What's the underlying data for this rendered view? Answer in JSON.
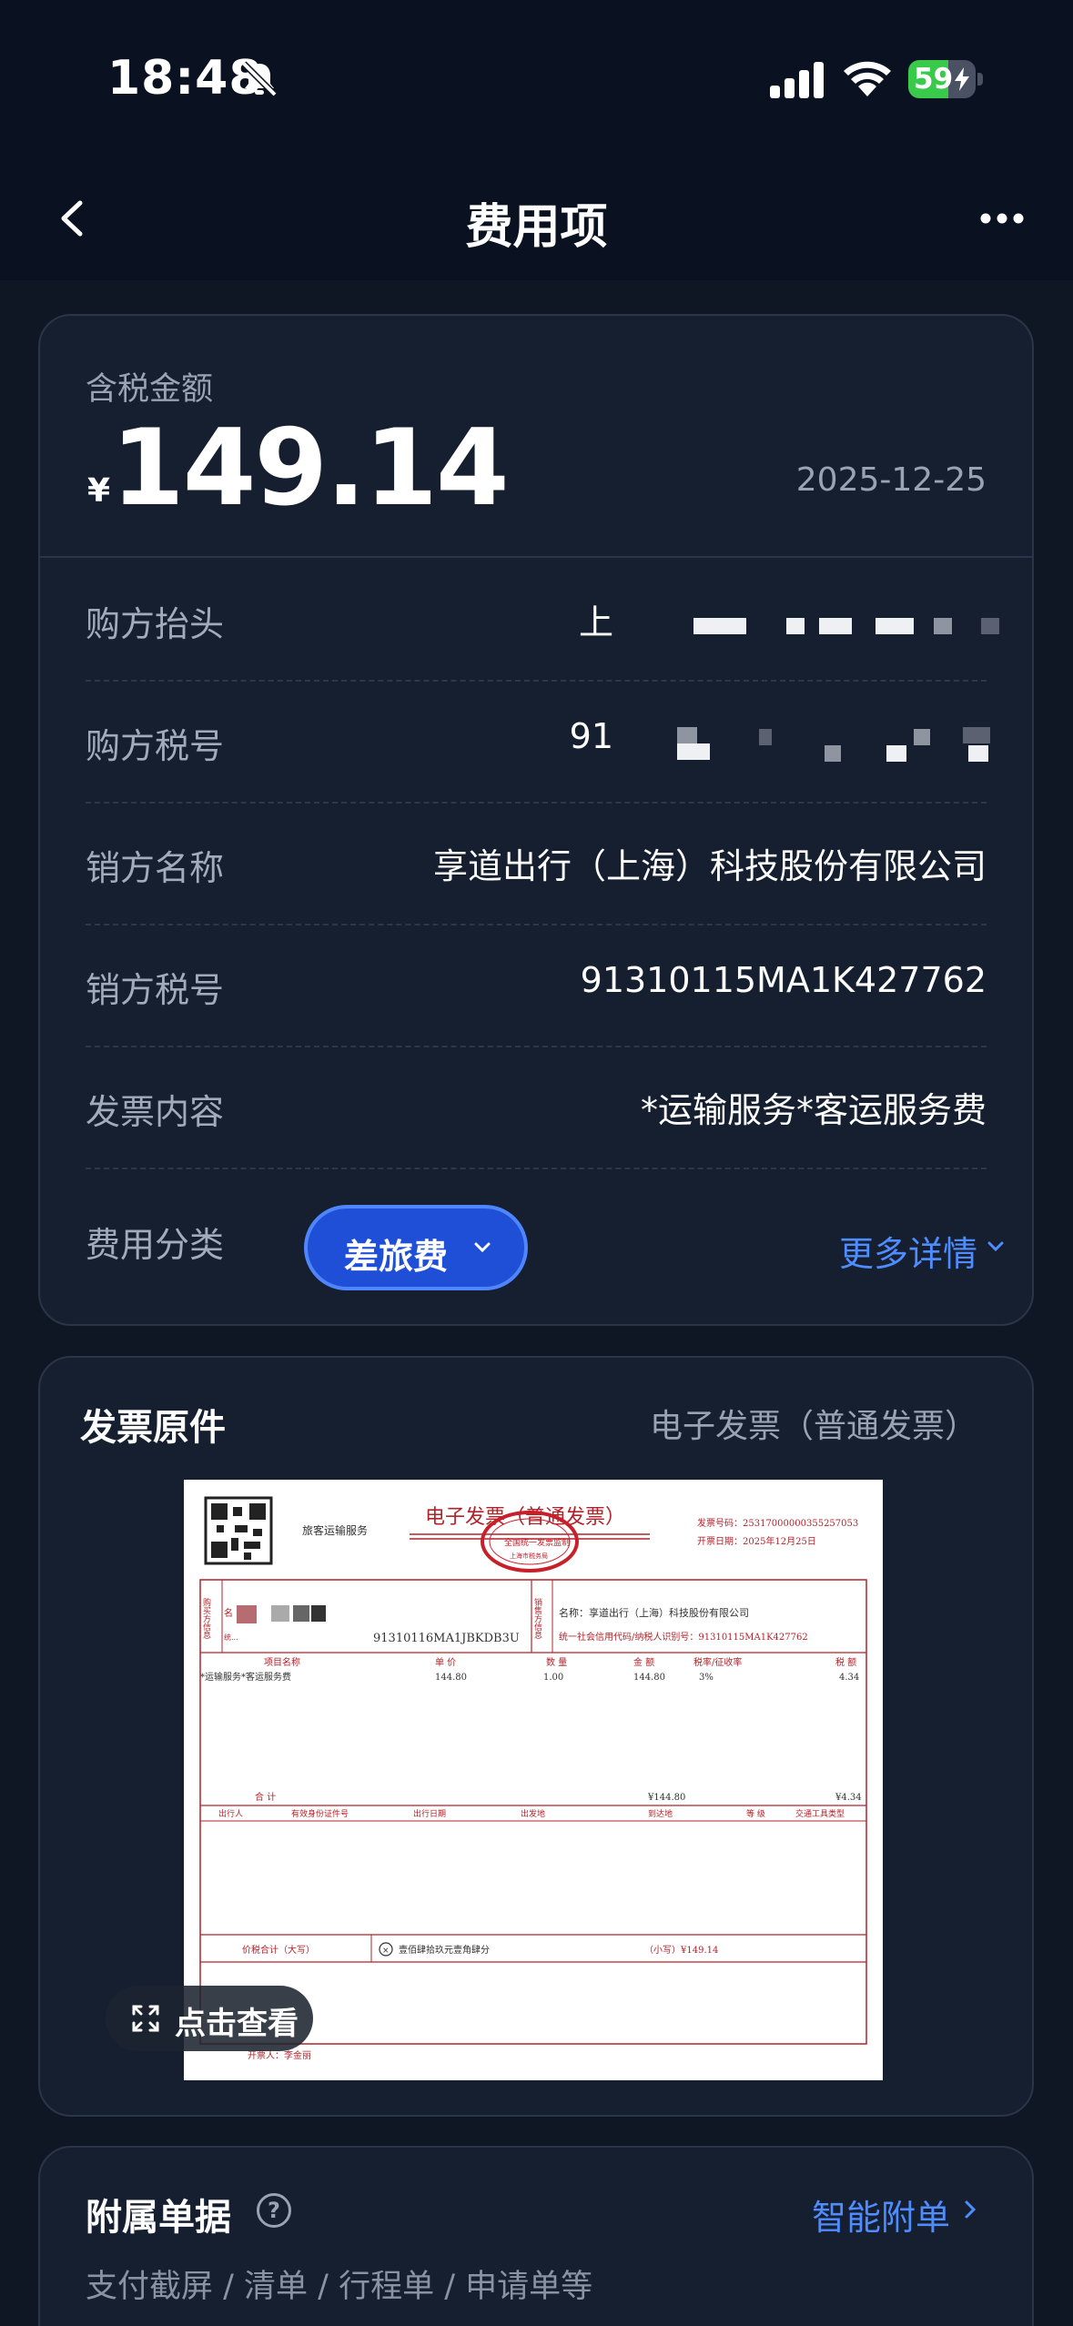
{
  "status_bar": {
    "time": "18:48",
    "battery": "59",
    "battery_level": 0.59
  },
  "nav": {
    "title": "费用项"
  },
  "amount_card": {
    "tax_label": "含税金额",
    "currency": "¥",
    "amount": "149.14",
    "date": "2025-12-25",
    "rows": [
      {
        "label": "购方抬头",
        "value": "上"
      },
      {
        "label": "购方税号",
        "value": "91"
      },
      {
        "label": "销方名称",
        "value": "享道出行（上海）科技股份有限公司"
      },
      {
        "label": "销方税号",
        "value": "91310115MA1K427762"
      },
      {
        "label": "发票内容",
        "value": "*运输服务*客运服务费"
      }
    ],
    "category_label": "费用分类",
    "category_value": "差旅费",
    "more_details": "更多详情"
  },
  "invoice_card": {
    "title": "发票原件",
    "type": "电子发票（普通发票）",
    "view_button": "点击查看",
    "image": {
      "service_tag": "旅客运输服务",
      "heading": "电子发票（普通发票）",
      "invoice_no": "发票号码：25317000000355257053",
      "invoice_date": "开票日期：2025年12月25日",
      "buyer_side": "购买方信息",
      "buyer_tax_id": "91310116MA1JBKDB3U",
      "seller_side": "销售方信息",
      "seller_name": "名称：享道出行（上海）科技股份有限公司",
      "seller_tax_id": "统一社会信用代码/纳税人识别号：91310115MA1K427762",
      "col_item": "项目名称",
      "col_price": "单 价",
      "col_qty": "数 量",
      "col_amount": "金 额",
      "col_rate": "税率/征收率",
      "col_tax": "税 额",
      "item_name": "*运输服务*客运服务费",
      "item_price": "144.80",
      "item_qty": "1.00",
      "item_amount": "144.80",
      "item_rate": "3%",
      "item_tax": "4.34",
      "total_label": "合 计",
      "total_amount": "¥144.80",
      "total_tax": "¥4.34",
      "trav_cols": [
        "出行人",
        "有效身份证件号",
        "出行日期",
        "出发地",
        "到达地",
        "等 级",
        "交通工具类型"
      ],
      "sum_label": "价税合计（大写）",
      "sum_words": "壹佰肆拾玖元壹角肆分",
      "sum_small": "（小写）¥149.14",
      "issuer": "开票人：李金丽"
    }
  },
  "attachments_card": {
    "title": "附属单据",
    "help": "?",
    "smart_attach": "智能附单",
    "subtitle": "支付截屏 / 清单 / 行程单 / 申请单等"
  }
}
